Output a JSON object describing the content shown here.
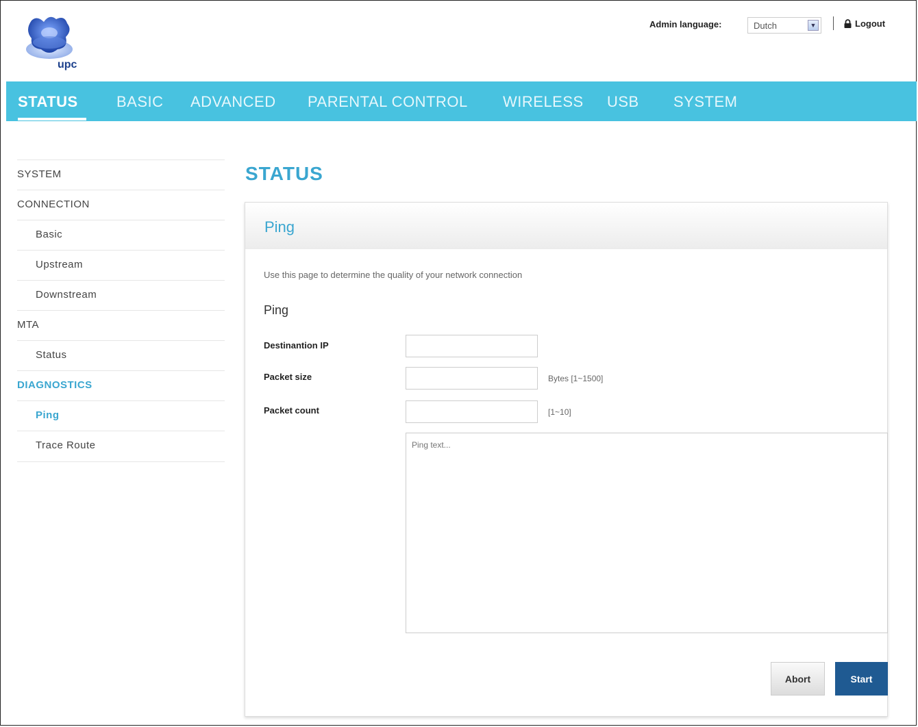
{
  "header": {
    "logo_text": "upc",
    "admin_language_label": "Admin language:",
    "language_value": "Dutch",
    "logout_label": "Logout"
  },
  "nav": {
    "items": [
      "STATUS",
      "BASIC",
      "ADVANCED",
      "PARENTAL CONTROL",
      "WIRELESS",
      "USB",
      "SYSTEM"
    ],
    "active": "STATUS"
  },
  "sidebar": {
    "items": [
      {
        "label": "SYSTEM",
        "level": 0
      },
      {
        "label": "CONNECTION",
        "level": 0
      },
      {
        "label": "Basic",
        "level": 1
      },
      {
        "label": "Upstream",
        "level": 1
      },
      {
        "label": "Downstream",
        "level": 1
      },
      {
        "label": "MTA",
        "level": 0
      },
      {
        "label": "Status",
        "level": 1
      },
      {
        "label": "DIAGNOSTICS",
        "level": 0,
        "active": true
      },
      {
        "label": "Ping",
        "level": 1,
        "active": true
      },
      {
        "label": "Trace Route",
        "level": 1
      }
    ]
  },
  "main": {
    "page_title": "STATUS",
    "panel_title": "Ping",
    "description": "Use this page to determine the quality of your network connection",
    "section_title": "Ping",
    "fields": {
      "destination_label": "Destinantion IP",
      "destination_value": "",
      "packet_size_label": "Packet size",
      "packet_size_value": "",
      "packet_size_hint": "Bytes [1~1500]",
      "packet_count_label": "Packet count",
      "packet_count_value": "",
      "packet_count_hint": "[1~10]"
    },
    "output_placeholder": "Ping text...",
    "abort_label": "Abort",
    "start_label": "Start"
  },
  "colors": {
    "nav_bg": "#48c2e0",
    "accent": "#3aa6d0",
    "start_button": "#1f5a92"
  }
}
